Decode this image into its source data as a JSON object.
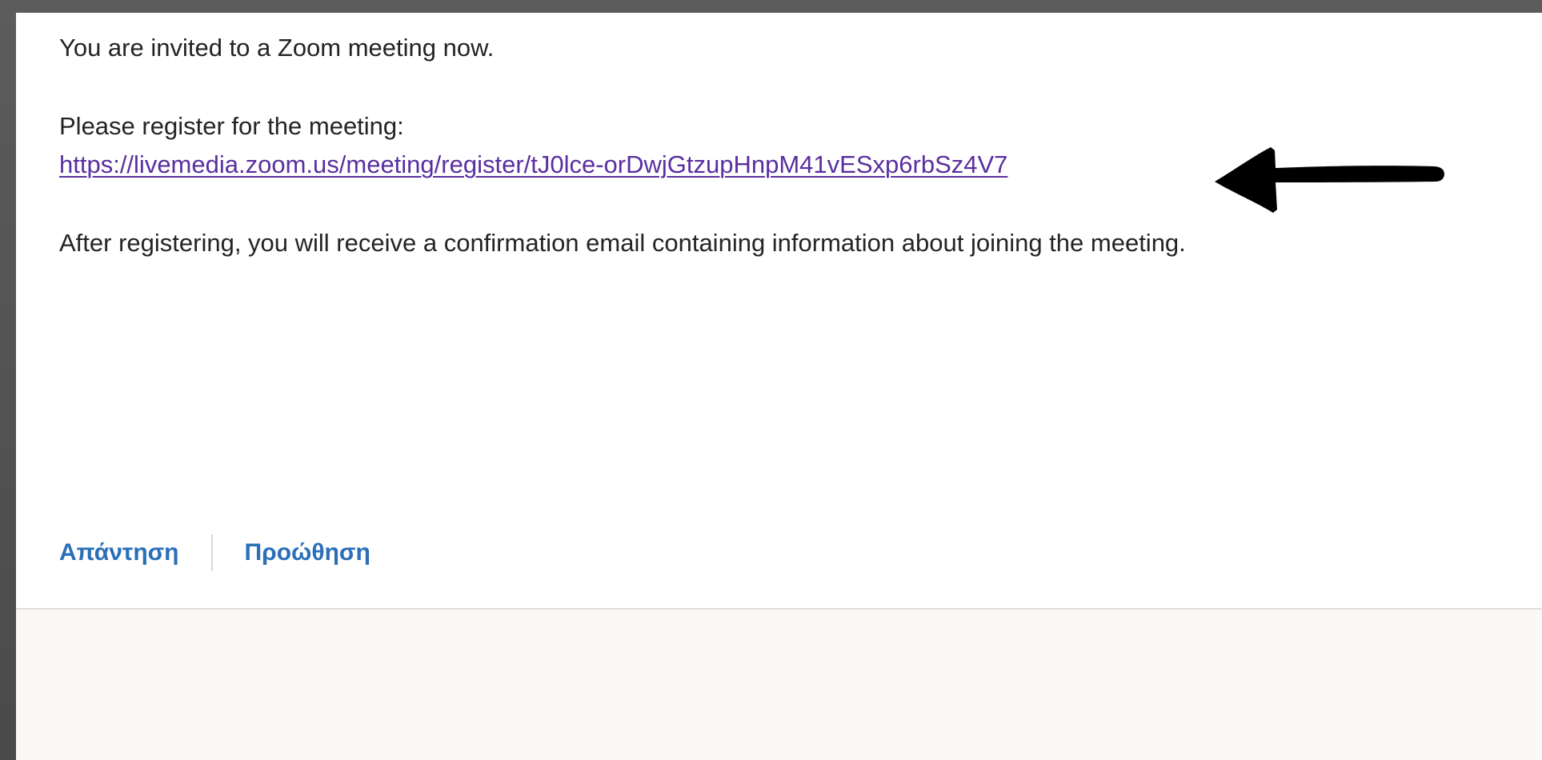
{
  "message": {
    "line_invite": "You are invited to a Zoom meeting now.",
    "line_register_prompt": "Please register for the meeting:",
    "register_link": "https://livemedia.zoom.us/meeting/register/tJ0lce-orDwjGtzupHnpM41vESxp6rbSz4V7",
    "line_after": "After registering, you will receive a confirmation email containing information about joining the meeting."
  },
  "annotation": {
    "icon": "arrow-left-icon",
    "color": "#000000"
  },
  "actions": {
    "reply_label": "Απάντηση",
    "forward_label": "Προώθηση"
  },
  "colors": {
    "link": "#5a2fa0",
    "action": "#2a6fb8",
    "text": "#252423",
    "footer_bg": "#faf9f8"
  }
}
